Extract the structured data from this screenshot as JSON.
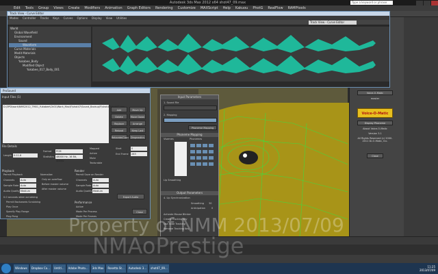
{
  "window": {
    "title": "Autodesk 3ds Max 2012 x64    shot47_09.max",
    "search_placeholder": "Type a keyword or phrase"
  },
  "menubar": [
    "Edit",
    "Tools",
    "Group",
    "Views",
    "Create",
    "Modifiers",
    "Animation",
    "Graph Editors",
    "Rendering",
    "Customize",
    "MAXScript",
    "Help",
    "Kakuou",
    "PhotG",
    "RealFlow",
    "RAMPtools"
  ],
  "trackview": {
    "title": "Track View - Curve Editor",
    "menu": [
      "Modes",
      "Controller",
      "Tracks",
      "Keys",
      "Curves",
      "Options",
      "Display",
      "View",
      "Utilities"
    ],
    "field": "Track View - Curve Editor",
    "tree": [
      "World",
      "Global Wavefield",
      "Environment",
      "Sound",
      "Waveform",
      "Curve Materials",
      "Medit Materials",
      "Objects",
      "Yukabee_Body",
      "Modified Object",
      "Yukabee_017_Body_001"
    ],
    "selected_index": 4
  },
  "prosound": {
    "title": "ProSound",
    "input_files_label": "Input Files (1)",
    "file_path": "D:\\3PD\\work\\NMS2012_TM01_Yukabee\\Ch01\\Work_Max\\F\\shot47\\Sound_Backup\\F\\shot47\\shot47.wav",
    "buttons_a": [
      "Add",
      "Delete",
      "Replace",
      "Reload",
      "Relocate/Copy"
    ],
    "buttons_b": [
      "Move Up",
      "Move Down",
      "Arrange",
      "Keep Last",
      "Diagnostics"
    ],
    "file_details_label": "File Details",
    "format_label": "Format",
    "format_value": "PCM",
    "statistics_label": "Statistics",
    "statistics_value": "48000 Hz, 16 Bit, Stereo",
    "length_label": "Length",
    "length_value": "0:11.8",
    "start_label": "Start",
    "start_value": "0",
    "end_label": "End Frame",
    "end_value": "283",
    "options": [
      "Mapped",
      "Active",
      "Mute",
      "Texturable"
    ],
    "playback_label": "Playback",
    "permit_playback": "Permit Playback",
    "channels_label": "Channels",
    "channels_value": "Auto",
    "sample_rate_label": "Sample Rate",
    "sample_rate_value": "Auto",
    "audio_quality_label": "Audio Quality",
    "audio_quality_value": "Medium",
    "normalize_label": "Normalize",
    "normalize_opts": [
      "Only on overflow",
      "Before master volume",
      "After master volume"
    ],
    "render_label": "Render",
    "render_opt": "Permit Save on Render",
    "export_button": "Export Audio",
    "scrub_label": "seconds when scrubbing",
    "scrub_value": "0.0",
    "extra_opts": [
      "Permit Backwards Scrubbing",
      "Play Once",
      "Specify Play Range",
      "Ping Pong"
    ],
    "performance_label": "Performance",
    "perf_opts": [
      "Active",
      "Mode Per Process",
      "Mode Per Frames"
    ],
    "time_label": "Time",
    "close_button": "Close"
  },
  "input_params": {
    "header": "Input Parameters",
    "sound_file_label": "1. Sound File",
    "sound_bar": "",
    "mapping_label": "2. Mapping",
    "mapping_button": "Phoneme Mapping",
    "phoneme_section": "Phoneme Mapping",
    "visemes_label": "Visemes",
    "phonemes_label": "Phonemes",
    "visemes": [
      "Viseme",
      "AI",
      "E",
      "O",
      "U",
      "FV",
      "WQ",
      "L",
      "MBP",
      "etc"
    ],
    "lip_sync_opt": "Lip Smoothing",
    "output_header": "Output Parameters",
    "lip_sync_label": "4. Lip Synchronization",
    "smoothing_label": "Smoothing",
    "smoothing_value": "30",
    "anticipation_label": "Anticipation",
    "anticipation_value": "0",
    "output_opts": [
      "Activate Mouse Blinker",
      "Create Tracking key",
      "Use Slide Tracking",
      "Remove Tracking Key"
    ]
  },
  "voice_panel": {
    "button_top": "Voice-O-Matic",
    "subtitle": "master",
    "logo": "Voice-O-Matic",
    "display_button": "Display Phoneme",
    "about_label": "About Voice-O-Matic",
    "version": "Version 3.1",
    "rights": "All Rights Reserved (c) 2000-2011 Di-O-Matic, Inc.",
    "close_button": "Close"
  },
  "watermark": {
    "line1": "Property of NMM 2013/07/09",
    "line2": "NMAoPrestige"
  },
  "taskbar": {
    "items": [
      "Windows",
      "Dropbox Co...",
      "Untitl...",
      "Adobe Photo...",
      "3ds Max",
      "Rosetta St...",
      "Autodesk 3...",
      "shot47_09..."
    ],
    "time": "11:25",
    "date": "2013/07/09"
  }
}
